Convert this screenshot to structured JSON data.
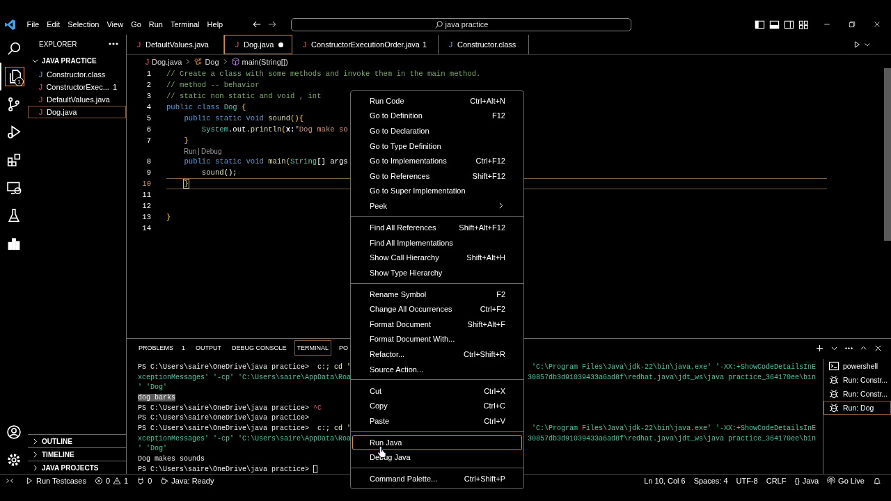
{
  "title_bar": {
    "menus": [
      "File",
      "Edit",
      "Selection",
      "View",
      "Go",
      "Run",
      "Terminal",
      "Help"
    ],
    "search": "java practice"
  },
  "activity_bar": {
    "items": [
      {
        "kind": "search",
        "selected": false
      },
      {
        "kind": "explorer",
        "selected": true,
        "badge": "1"
      },
      {
        "kind": "source_control",
        "selected": false
      },
      {
        "kind": "run_debug",
        "selected": false
      },
      {
        "kind": "extensions",
        "selected": false
      },
      {
        "kind": "remote",
        "selected": false
      },
      {
        "kind": "testing",
        "selected": false
      },
      {
        "kind": "chart",
        "selected": false
      }
    ],
    "bottom": [
      {
        "kind": "account"
      },
      {
        "kind": "settings"
      }
    ]
  },
  "sidebar": {
    "title": "EXPLORER",
    "folder": {
      "label": "JAVA PRACTICE",
      "expanded": true,
      "files": [
        {
          "icon": "J",
          "name": "Constructor.class",
          "kind": "class",
          "selected": false
        },
        {
          "icon": "J",
          "name": "ConstructorExec...",
          "kind": "java",
          "problems": "1",
          "selected": false
        },
        {
          "icon": "J",
          "name": "DefaultValues.java",
          "kind": "java",
          "selected": false
        },
        {
          "icon": "J",
          "name": "Dog.java",
          "kind": "java",
          "selected": true
        }
      ]
    },
    "sections": [
      {
        "label": "OUTLINE",
        "expanded": false
      },
      {
        "label": "TIMELINE",
        "expanded": false
      },
      {
        "label": "JAVA PROJECTS",
        "expanded": false
      }
    ]
  },
  "tabs": [
    {
      "icon": "J",
      "name": "DefaultValues.java",
      "kind": "java",
      "selected": false,
      "modified": false
    },
    {
      "icon": "J",
      "name": "Dog.java",
      "kind": "java",
      "selected": true,
      "modified": true
    },
    {
      "icon": "J",
      "name": "ConstructorExecutionOrder.java",
      "kind": "java",
      "problems": "1",
      "selected": false,
      "modified": false
    },
    {
      "icon": "J",
      "name": "Constructor.class",
      "kind": "class",
      "selected": false,
      "modified": false
    }
  ],
  "breadcrumbs": [
    {
      "kind": "file",
      "icon": "J",
      "text": "Dog.java"
    },
    {
      "kind": "class",
      "text": "Dog"
    },
    {
      "kind": "method",
      "text": "main(String[])"
    }
  ],
  "editor": {
    "lines": [
      {
        "kind": "code",
        "number": "1",
        "active": false,
        "tokens": [
          {
            "text": "// Create a class with some methods and invoke them in the main method.",
            "kind": "comment"
          }
        ]
      },
      {
        "kind": "code",
        "number": "2",
        "active": false,
        "tokens": [
          {
            "text": "// method -- behavior",
            "kind": "comment"
          }
        ]
      },
      {
        "kind": "code",
        "number": "3",
        "active": false,
        "tokens": [
          {
            "text": "// static non static and void , int",
            "kind": "comment"
          }
        ]
      },
      {
        "kind": "code",
        "number": "4",
        "active": false,
        "tokens": [
          {
            "text": "public class ",
            "kind": "keyword"
          },
          {
            "text": "Dog",
            "kind": "type"
          },
          {
            "text": " {",
            "kind": "brace"
          }
        ]
      },
      {
        "kind": "code",
        "number": "5",
        "active": false,
        "tokens": [
          {
            "text": "    public static void ",
            "kind": "keyword"
          },
          {
            "text": "sound",
            "kind": "function"
          },
          {
            "text": "(){",
            "kind": "brace"
          }
        ]
      },
      {
        "kind": "code",
        "number": "6",
        "active": false,
        "tokens": [
          {
            "text": "        System",
            "kind": "type"
          },
          {
            "text": ".out.",
            "kind": "plain"
          },
          {
            "text": "println",
            "kind": "function"
          },
          {
            "text": "(",
            "kind": "brace"
          },
          {
            "text": "x:",
            "kind": "param"
          },
          {
            "text": "\"Dog make so",
            "kind": "string"
          }
        ]
      },
      {
        "kind": "code",
        "number": "7",
        "active": false,
        "tokens": [
          {
            "text": "    }",
            "kind": "brace"
          }
        ]
      },
      {
        "kind": "codelens",
        "links": [
          "Run",
          "Debug"
        ],
        "separator": "|"
      },
      {
        "kind": "code",
        "number": "8",
        "active": false,
        "tokens": [
          {
            "text": "    public static void ",
            "kind": "keyword"
          },
          {
            "text": "main",
            "kind": "function"
          },
          {
            "text": "(",
            "kind": "brace"
          },
          {
            "text": "String",
            "kind": "type"
          },
          {
            "text": "[] args",
            "kind": "plain"
          }
        ]
      },
      {
        "kind": "code",
        "number": "9",
        "active": false,
        "tokens": [
          {
            "text": "        sound",
            "kind": "function"
          },
          {
            "text": "();",
            "kind": "plain"
          }
        ]
      },
      {
        "kind": "code",
        "number": "10",
        "active": true,
        "tokens": [
          {
            "text": "    }",
            "kind": "bracket_match"
          }
        ]
      },
      {
        "kind": "code",
        "number": "11",
        "active": false
      },
      {
        "kind": "code",
        "number": "12",
        "active": false
      },
      {
        "kind": "code",
        "number": "13",
        "active": false,
        "tokens": [
          {
            "text": "}",
            "kind": "brace"
          }
        ]
      },
      {
        "kind": "code",
        "number": "14",
        "active": false
      }
    ]
  },
  "panel": {
    "tabs": [
      {
        "label": "PROBLEMS",
        "count": "1",
        "selected": false
      },
      {
        "label": "OUTPUT",
        "selected": false
      },
      {
        "label": "DEBUG CONSOLE",
        "selected": false
      },
      {
        "label": "TERMINAL",
        "selected": true
      },
      {
        "label": "PO",
        "selected": false
      }
    ],
    "terminal": [
      {
        "cursor": false,
        "left": [
          {
            "text": "PS C:\\Users\\saire\\OneDrive\\java practice>",
            "kind": "prompt"
          },
          {
            "text": "  c:; cd '",
            "kind": "command"
          }
        ],
        "right": [
          {
            "text": "'C:\\Program Files\\Java\\jdk-22\\bin\\java.exe' '-XX:+ShowCodeDetailsInE",
            "kind": "argument"
          }
        ]
      },
      {
        "cursor": false,
        "left": [
          {
            "text": "xceptionMessages' '-cp' 'C:\\Users\\saire\\AppData\\Roa",
            "kind": "argument"
          }
        ],
        "right": [
          {
            "text": "30857db3d91039433a6ad8f\\redhat.java\\jdt_ws\\java practice_364170ee\\bin",
            "kind": "argument"
          }
        ]
      },
      {
        "cursor": false,
        "left": [
          {
            "text": "' 'Dog'",
            "kind": "argument"
          }
        ]
      },
      {
        "cursor": false,
        "left": [
          {
            "text": "dog barks",
            "kind": "selection"
          }
        ]
      },
      {
        "cursor": false,
        "left": [
          {
            "text": "PS C:\\Users\\saire\\OneDrive\\java practice>",
            "kind": "prompt"
          },
          {
            "text": " ^C",
            "kind": "error"
          }
        ]
      },
      {
        "cursor": false,
        "left": [
          {
            "text": "PS C:\\Users\\saire\\OneDrive\\java practice>",
            "kind": "prompt"
          }
        ]
      },
      {
        "cursor": false,
        "left": [
          {
            "text": "PS C:\\Users\\saire\\OneDrive\\java practice>",
            "kind": "prompt"
          },
          {
            "text": "  c:; cd '",
            "kind": "command"
          }
        ],
        "right": [
          {
            "text": "'C:\\Program Files\\Java\\jdk-22\\bin\\java.exe' '-XX:+ShowCodeDetailsInE",
            "kind": "argument"
          }
        ]
      },
      {
        "cursor": false,
        "left": [
          {
            "text": "xceptionMessages' '-cp' 'C:\\Users\\saire\\AppData\\Roa",
            "kind": "argument"
          }
        ],
        "right": [
          {
            "text": "30857db3d91039433a6ad8f\\redhat.java\\jdt_ws\\java practice_364170ee\\bin",
            "kind": "argument"
          }
        ]
      },
      {
        "cursor": false,
        "left": [
          {
            "text": "' 'Dog'",
            "kind": "argument"
          }
        ]
      },
      {
        "cursor": false,
        "left": [
          {
            "text": "Dog makes sounds",
            "kind": "output"
          }
        ]
      },
      {
        "cursor": true,
        "left": [
          {
            "text": "PS C:\\Users\\saire\\OneDrive\\java practice>",
            "kind": "prompt"
          }
        ]
      }
    ],
    "terminals": [
      {
        "label": "powershell",
        "kind": "shell",
        "selected": false
      },
      {
        "label": "Run: Constr...",
        "kind": "debug",
        "selected": false
      },
      {
        "label": "Run: Constr...",
        "kind": "debug",
        "selected": false
      },
      {
        "label": "Run: Dog",
        "kind": "debug",
        "selected": true
      }
    ]
  },
  "context_menu": {
    "groups": [
      [
        {
          "label": "Run Code",
          "shortcut": "Ctrl+Alt+N",
          "submenu": false,
          "selected": false
        },
        {
          "label": "Go to Definition",
          "shortcut": "F12",
          "submenu": false,
          "selected": false
        },
        {
          "label": "Go to Declaration",
          "submenu": false,
          "selected": false
        },
        {
          "label": "Go to Type Definition",
          "submenu": false,
          "selected": false
        },
        {
          "label": "Go to Implementations",
          "shortcut": "Ctrl+F12",
          "submenu": false,
          "selected": false
        },
        {
          "label": "Go to References",
          "shortcut": "Shift+F12",
          "submenu": false,
          "selected": false
        },
        {
          "label": "Go to Super Implementation",
          "submenu": false,
          "selected": false
        },
        {
          "label": "Peek",
          "submenu": true,
          "selected": false
        }
      ],
      [
        {
          "label": "Find All References",
          "shortcut": "Shift+Alt+F12",
          "submenu": false,
          "selected": false
        },
        {
          "label": "Find All Implementations",
          "submenu": false,
          "selected": false
        },
        {
          "label": "Show Call Hierarchy",
          "shortcut": "Shift+Alt+H",
          "submenu": false,
          "selected": false
        },
        {
          "label": "Show Type Hierarchy",
          "submenu": false,
          "selected": false
        }
      ],
      [
        {
          "label": "Rename Symbol",
          "shortcut": "F2",
          "submenu": false,
          "selected": false
        },
        {
          "label": "Change All Occurrences",
          "shortcut": "Ctrl+F2",
          "submenu": false,
          "selected": false
        },
        {
          "label": "Format Document",
          "shortcut": "Shift+Alt+F",
          "submenu": false,
          "selected": false
        },
        {
          "label": "Format Document With...",
          "submenu": false,
          "selected": false
        },
        {
          "label": "Refactor...",
          "shortcut": "Ctrl+Shift+R",
          "submenu": false,
          "selected": false
        },
        {
          "label": "Source Action...",
          "submenu": false,
          "selected": false
        }
      ],
      [
        {
          "label": "Cut",
          "shortcut": "Ctrl+X",
          "submenu": false,
          "selected": false
        },
        {
          "label": "Copy",
          "shortcut": "Ctrl+C",
          "submenu": false,
          "selected": false
        },
        {
          "label": "Paste",
          "shortcut": "Ctrl+V",
          "submenu": false,
          "selected": false
        }
      ],
      [
        {
          "label": "Run Java",
          "submenu": false,
          "selected": true
        },
        {
          "label": "Debug Java",
          "submenu": false,
          "selected": false
        }
      ],
      [
        {
          "label": "Command Palette...",
          "shortcut": "Ctrl+Shift+P",
          "submenu": false,
          "selected": false
        }
      ]
    ]
  },
  "status_bar": {
    "left": [
      {
        "kind": "remote"
      },
      {
        "kind": "run",
        "text": "Run Testcases"
      },
      {
        "kind": "problems",
        "errors": "0",
        "warnings": "1"
      },
      {
        "kind": "ports",
        "text": "0"
      },
      {
        "kind": "java",
        "text": "Java: Ready"
      }
    ],
    "right": [
      {
        "kind": "text",
        "text": "Ln 10, Col 6"
      },
      {
        "kind": "text",
        "text": "Spaces: 4"
      },
      {
        "kind": "text",
        "text": "UTF-8"
      },
      {
        "kind": "text",
        "text": "CRLF"
      },
      {
        "kind": "language",
        "icon": "{}",
        "text": "Java"
      },
      {
        "kind": "live",
        "text": "Go Live"
      },
      {
        "kind": "bell"
      }
    ]
  }
}
